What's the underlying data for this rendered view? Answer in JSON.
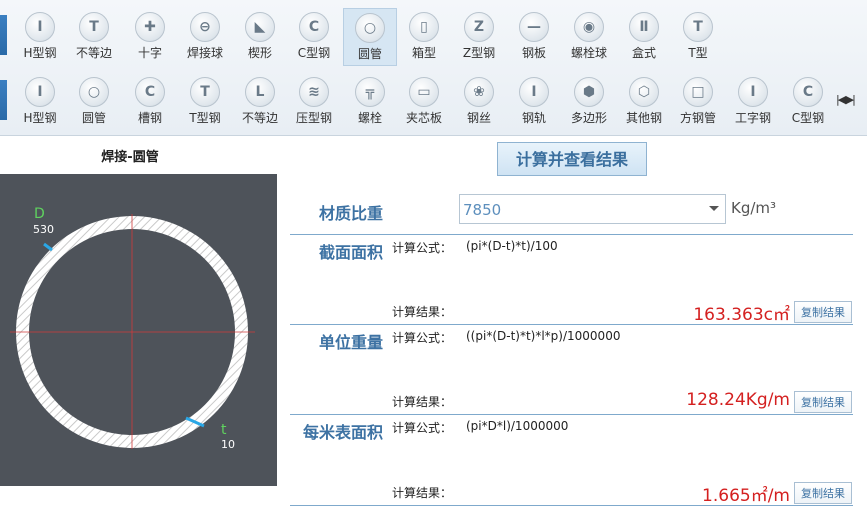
{
  "toolbar_row1": [
    {
      "label": "H型钢",
      "glyph": "I"
    },
    {
      "label": "不等边",
      "glyph": "T"
    },
    {
      "label": "十字",
      "glyph": "✚"
    },
    {
      "label": "焊接球",
      "glyph": "⊖"
    },
    {
      "label": "楔形",
      "glyph": "◣"
    },
    {
      "label": "C型钢",
      "glyph": "C"
    },
    {
      "label": "圆管",
      "glyph": "○"
    },
    {
      "label": "箱型",
      "glyph": "▯"
    },
    {
      "label": "Z型钢",
      "glyph": "Z"
    },
    {
      "label": "钢板",
      "glyph": "—"
    },
    {
      "label": "螺栓球",
      "glyph": "◉"
    },
    {
      "label": "盒式",
      "glyph": "Ⅱ"
    },
    {
      "label": "T型",
      "glyph": "T"
    }
  ],
  "toolbar_row2": [
    {
      "label": "H型钢",
      "glyph": "I"
    },
    {
      "label": "圆管",
      "glyph": "○"
    },
    {
      "label": "槽钢",
      "glyph": "C"
    },
    {
      "label": "T型钢",
      "glyph": "T"
    },
    {
      "label": "不等边",
      "glyph": "L"
    },
    {
      "label": "压型钢",
      "glyph": "≋"
    },
    {
      "label": "螺栓",
      "glyph": "╦"
    },
    {
      "label": "夹芯板",
      "glyph": "▭"
    },
    {
      "label": "钢丝",
      "glyph": "❀"
    },
    {
      "label": "钢轨",
      "glyph": "I"
    },
    {
      "label": "多边形",
      "glyph": "⬢"
    },
    {
      "label": "其他钢",
      "glyph": "⬡"
    },
    {
      "label": "方钢管",
      "glyph": "□"
    },
    {
      "label": "工字钢",
      "glyph": "I"
    },
    {
      "label": "C型钢",
      "glyph": "C"
    }
  ],
  "section_title": "焊接-圆管",
  "diagram": {
    "d_label": "D",
    "d_value": "530",
    "t_label": "t",
    "t_value": "10"
  },
  "calc_button": "计算并查看结果",
  "material": {
    "title": "材质比重",
    "value": "7850",
    "unit": "Kg/m³"
  },
  "rows": [
    {
      "title": "截面面积",
      "formula_label": "计算公式：",
      "formula": "(pi*(D-t)*t)/100",
      "result_label": "计算结果：",
      "result": "163.363c㎡",
      "copy": "复制结果"
    },
    {
      "title": "单位重量",
      "formula_label": "计算公式：",
      "formula": "((pi*(D-t)*t)*l*p)/1000000",
      "result_label": "计算结果：",
      "result": "128.24Kg/m",
      "copy": "复制结果"
    },
    {
      "title": "每米表面积",
      "formula_label": "计算公式：",
      "formula": "(pi*D*l)/1000000",
      "result_label": "计算结果：",
      "result": "1.665㎡/m",
      "copy": "复制结果"
    }
  ],
  "colors": {
    "accent": "#3d72a3",
    "result": "#d42020",
    "diagram_bg": "#4e535a"
  }
}
